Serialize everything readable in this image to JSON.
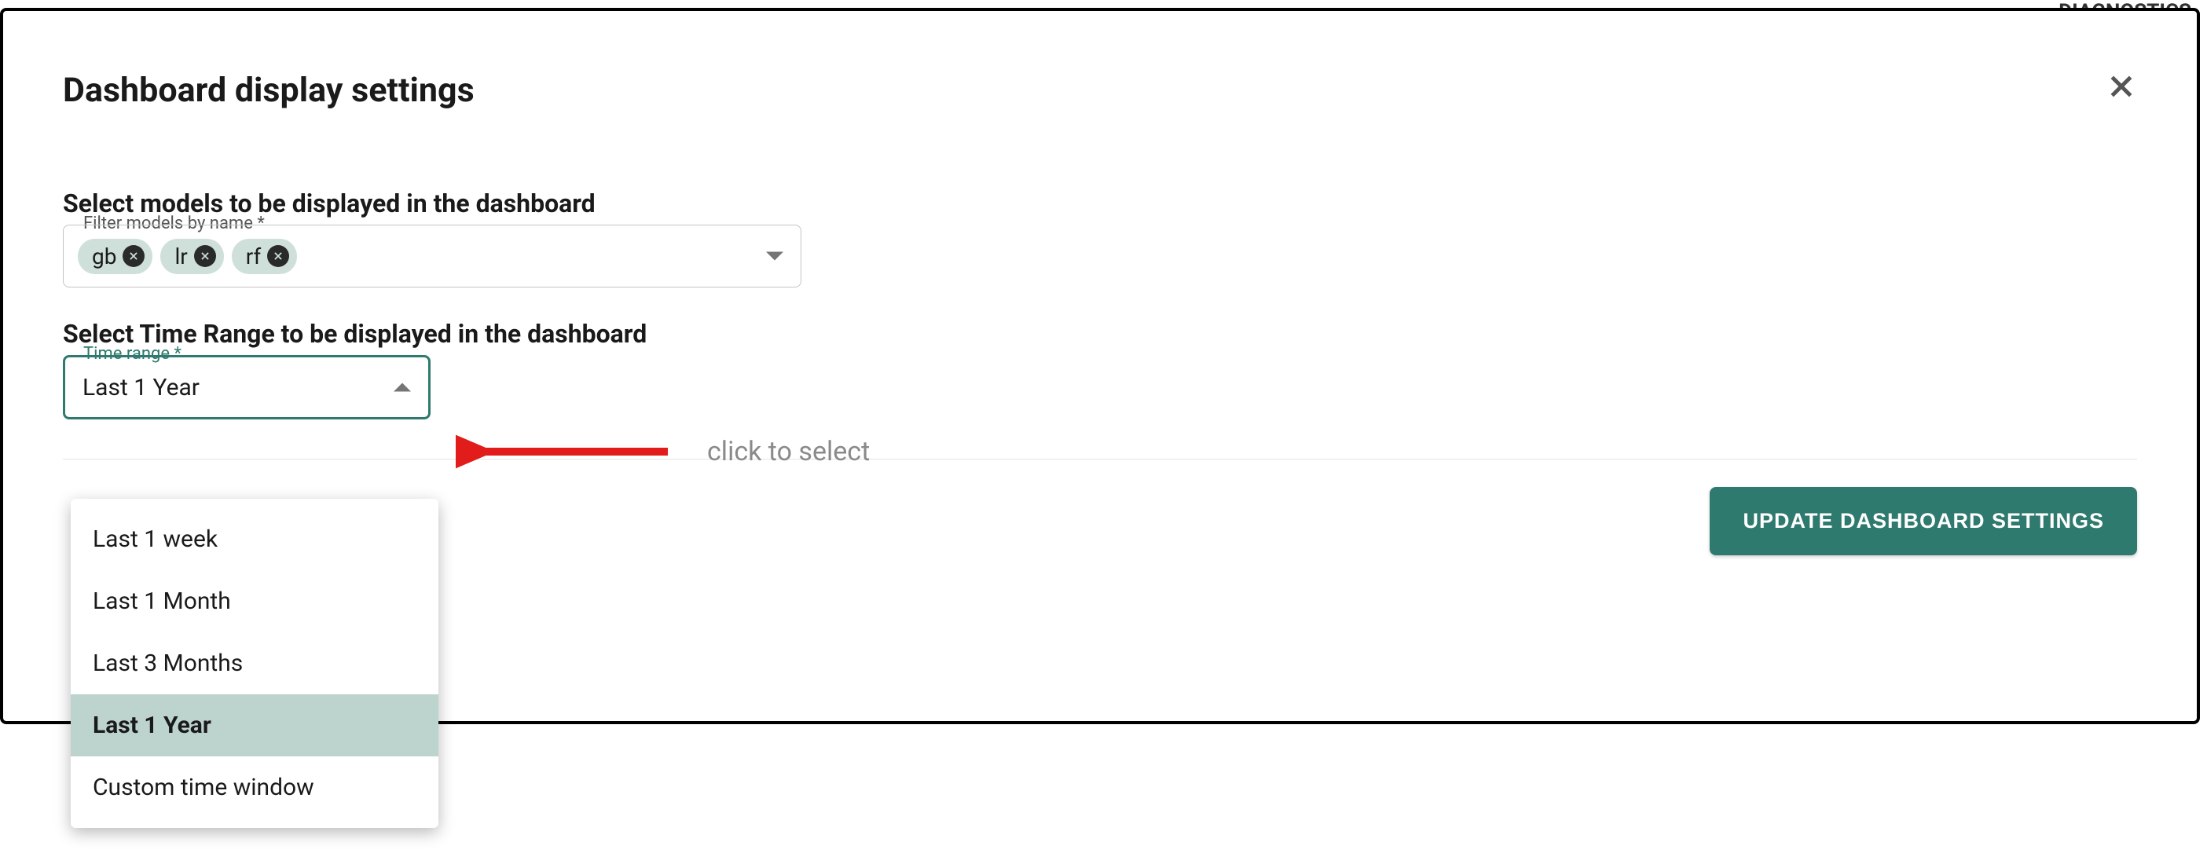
{
  "background": {
    "left_text": "",
    "right_text": "DIAGNOSTICS"
  },
  "modal": {
    "title": "Dashboard display settings"
  },
  "models_section": {
    "label": "Select models to be displayed in the dashboard",
    "field_legend": "Filter models by name *",
    "chips": [
      "gb",
      "lr",
      "rf"
    ]
  },
  "timerange_section": {
    "label": "Select Time Range to be displayed in the dashboard",
    "field_legend": "Time range *",
    "selected": "Last 1 Year",
    "options": [
      "Last 1 week",
      "Last 1 Month",
      "Last 3 Months",
      "Last 1 Year",
      "Custom time window"
    ]
  },
  "annotation": {
    "text": "click to select",
    "arrow_color": "#e21b1b"
  },
  "footer": {
    "button_label": "UPDATE DASHBOARD SETTINGS"
  },
  "colors": {
    "accent": "#2f7a6e",
    "chip_bg": "#cfe0db"
  }
}
